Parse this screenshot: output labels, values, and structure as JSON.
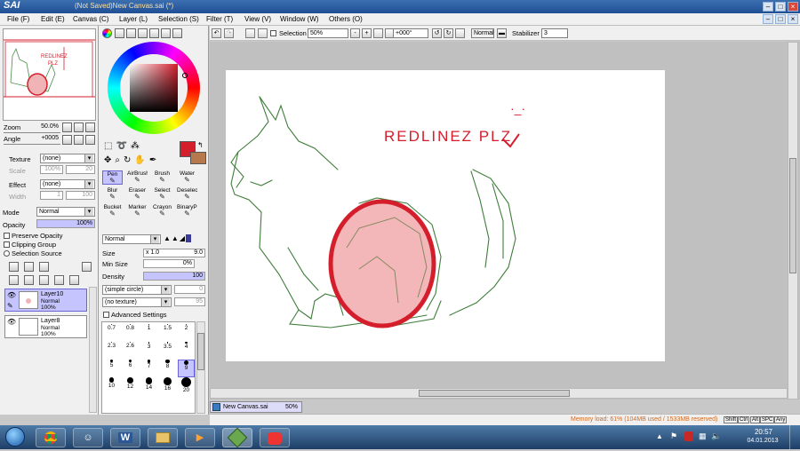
{
  "window": {
    "logo": "SAI",
    "title": "(Not Saved)New Canvas.sai (*)"
  },
  "menu": [
    "File (F)",
    "Edit (E)",
    "Canvas (C)",
    "Layer (L)",
    "Selection (S)",
    "Filter (T)",
    "View (V)",
    "Window (W)",
    "Others (O)"
  ],
  "toolbar": {
    "selection_label": "Selection",
    "zoom": "50%",
    "rotation": "+000°",
    "blend_mode": "Normal",
    "stabilizer_label": "Stabilizer",
    "stabilizer_value": "3"
  },
  "navigator": {
    "zoom_label": "Zoom",
    "zoom_value": "50.0%",
    "angle_label": "Angle",
    "angle_value": "+0005"
  },
  "layer_panel": {
    "texture_label": "Texture",
    "texture_value": "(none)",
    "scale_label": "Scale",
    "scale_value": "100%",
    "scale_num": "20",
    "effect_label": "Effect",
    "effect_value": "(none)",
    "width_label": "Width",
    "width_value": "1",
    "width_num": "100",
    "mode_label": "Mode",
    "mode_value": "Normal",
    "opacity_label": "Opacity",
    "opacity_value": "100%",
    "preserve_opacity": "Preserve Opacity",
    "clipping_group": "Clipping Group",
    "selection_source": "Selection Source",
    "layers": [
      {
        "name": "Layer10",
        "mode": "Normal",
        "opacity": "100%"
      },
      {
        "name": "Layer8",
        "mode": "Normal",
        "opacity": "100%"
      }
    ]
  },
  "colors": {
    "primary": "#d41e2c",
    "secondary": "#b5794d"
  },
  "tools": [
    {
      "label": "Pen",
      "icon": "pen-icon"
    },
    {
      "label": "AirBrush",
      "icon": "airbrush-icon"
    },
    {
      "label": "Brush",
      "icon": "brush-icon"
    },
    {
      "label": "Water",
      "icon": "water-icon"
    },
    {
      "label": "Blur",
      "icon": "blur-icon"
    },
    {
      "label": "Eraser",
      "icon": "eraser-icon"
    },
    {
      "label": "Select",
      "icon": "select-icon"
    },
    {
      "label": "Deselect",
      "icon": "deselect-icon"
    },
    {
      "label": "Bucket",
      "icon": "bucket-icon"
    },
    {
      "label": "Marker",
      "icon": "marker-icon"
    },
    {
      "label": "Crayon",
      "icon": "crayon-icon"
    },
    {
      "label": "BinaryPen",
      "icon": "binarypen-icon"
    }
  ],
  "tool_settings": {
    "mode": "Normal",
    "size_label": "Size",
    "size_multiplier": "x 1.0",
    "size_value": "9.0",
    "min_size_label": "Min Size",
    "min_size_value": "0%",
    "density_label": "Density",
    "density_value": "100",
    "shape": "(simple circle)",
    "shape_num": "0",
    "texture": "(no texture)",
    "texture_num": "95",
    "advanced_settings": "Advanced Settings",
    "brush_sizes": [
      "0.7",
      "0.8",
      "1",
      "1.5",
      "2",
      "2.3",
      "2.6",
      "3",
      "3.5",
      "4",
      "5",
      "6",
      "7",
      "8",
      "9",
      "10",
      "12",
      "14",
      "16",
      "20"
    ]
  },
  "canvas_text": "REDLINEZ PLZ",
  "canvas_face": "·_·",
  "document_tab": {
    "name": "New Canvas.sai",
    "zoom": "50%"
  },
  "status": {
    "memory": "Memory load: 61% (104MB used / 1533MB reserved)",
    "keys": [
      "Shift",
      "Ctrl",
      "Alt",
      "SPC",
      "Any"
    ]
  },
  "taskbar": {
    "time": "20:57",
    "date": "04.01.2013"
  }
}
